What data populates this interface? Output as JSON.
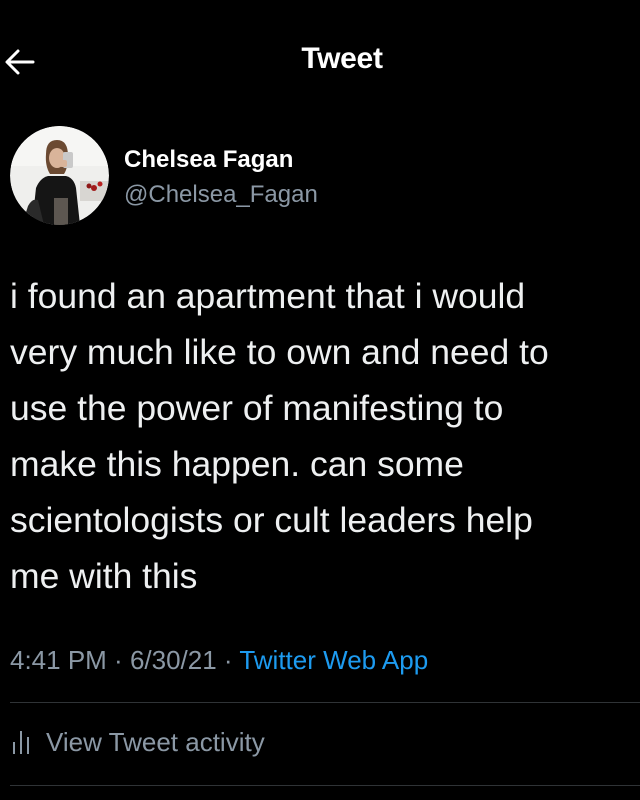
{
  "header": {
    "back_icon": "arrow-left-icon",
    "title": "Tweet"
  },
  "author": {
    "avatar_icon": "profile-photo",
    "name": "Chelsea Fagan",
    "handle": "@Chelsea_Fagan"
  },
  "tweet": {
    "text": "i found an apartment that i would\nvery much like to own and need to\nuse the power of manifesting to\nmake this happen. can some\nscientologists or cult leaders help\nme with this",
    "time": "4:41 PM",
    "separator": " · ",
    "date": "6/30/21",
    "source": "Twitter Web App"
  },
  "activity": {
    "icon": "bar-chart-icon",
    "label": "View Tweet activity"
  },
  "colors": {
    "background": "#000000",
    "text": "#e7e9ea",
    "secondary": "#8b98a5",
    "link": "#1d9bf0",
    "divider": "#2f3336"
  }
}
